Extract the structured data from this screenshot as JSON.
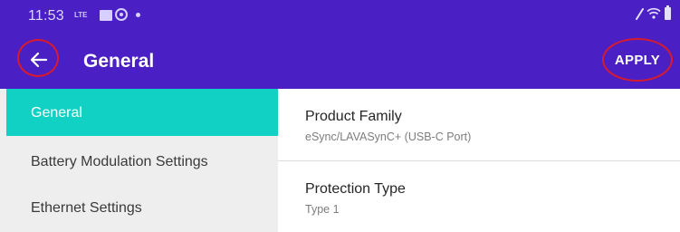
{
  "status_bar": {
    "time": "11:53",
    "network": "LTE",
    "icons": [
      "gallery-icon",
      "target-icon",
      "dot-icon",
      "edit-icon",
      "wifi-icon",
      "battery-icon"
    ]
  },
  "header": {
    "title": "General",
    "apply_label": "APPLY",
    "back_icon": "arrow-left-icon",
    "background": "#4a1fc4",
    "highlight_color": "#d81b2c"
  },
  "sidebar": {
    "active_color": "#11d1c4",
    "items": [
      {
        "label": "General",
        "active": true
      },
      {
        "label": "Battery Modulation Settings",
        "active": false
      },
      {
        "label": "Ethernet Settings",
        "active": false
      }
    ]
  },
  "content": {
    "fields": [
      {
        "title": "Product Family",
        "value": "eSync/LAVASynC+ (USB-C Port)"
      },
      {
        "title": "Protection Type",
        "value": "Type 1"
      }
    ]
  }
}
